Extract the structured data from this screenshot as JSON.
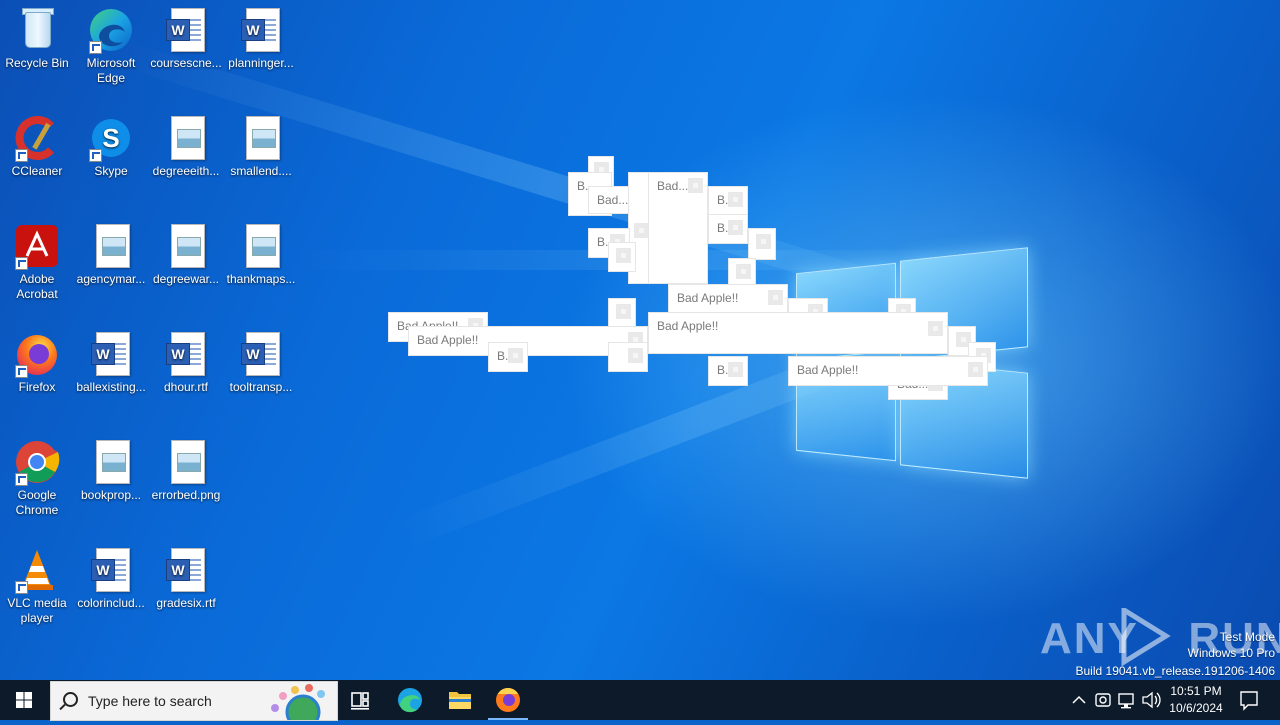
{
  "desktop_icons": [
    {
      "label": "Recycle Bin"
    },
    {
      "label": "Microsoft Edge"
    },
    {
      "label": "coursescne..."
    },
    {
      "label": "planninger..."
    },
    {
      "label": "CCleaner"
    },
    {
      "label": "Skype"
    },
    {
      "label": "degreeeith..."
    },
    {
      "label": "smallend...."
    },
    {
      "label": "Adobe Acrobat"
    },
    {
      "label": "agencymar..."
    },
    {
      "label": "degreewar..."
    },
    {
      "label": "thankmaps..."
    },
    {
      "label": "Firefox"
    },
    {
      "label": "ballexisting..."
    },
    {
      "label": "dhour.rtf"
    },
    {
      "label": "tooltransp..."
    },
    {
      "label": "Google Chrome"
    },
    {
      "label": "bookprop..."
    },
    {
      "label": "errorbed.png"
    },
    {
      "label": "VLC media player"
    },
    {
      "label": "colorinclud..."
    },
    {
      "label": "gradesix.rtf"
    }
  ],
  "popups": {
    "full": "Bad Apple!!",
    "short": "Bad...",
    "tiny": "B.",
    "mid": "Bad..."
  },
  "taskbar": {
    "search_placeholder": "Type here to search",
    "time": "10:51 PM",
    "date": "10/6/2024"
  },
  "watermark": {
    "brand": "ANY RUN",
    "line1": "Test Mode",
    "line2": "Windows 10 Pro",
    "line3": "Build 19041.vb_release.191206-1406"
  }
}
